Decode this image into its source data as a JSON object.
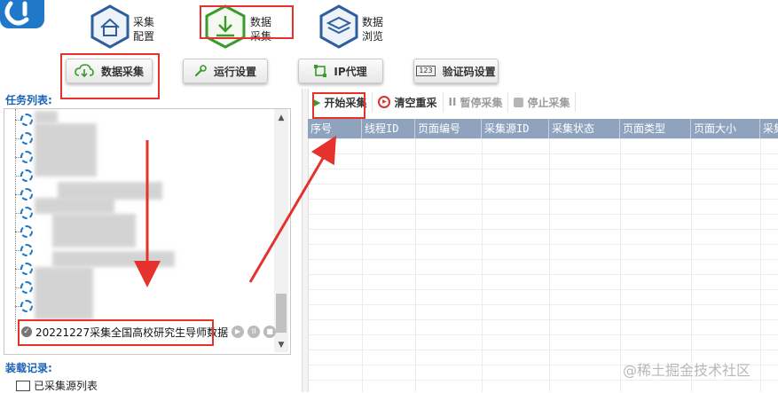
{
  "header": {
    "nav": [
      {
        "line1": "采集",
        "line2": "配置"
      },
      {
        "line1": "数据",
        "line2": "采集"
      },
      {
        "line1": "数据",
        "line2": "浏览"
      }
    ]
  },
  "toolbar": {
    "data_collect": "数据采集",
    "run_settings": "运行设置",
    "ip_proxy": "IP代理",
    "captcha_settings": "验证码设置",
    "captcha_icon_text": "123"
  },
  "left": {
    "task_list_title": "任务列表:",
    "task_item_label": "20221227采集全国高校研究生导师数据",
    "load_title": "装载记录:",
    "load_item": "已采集源列表"
  },
  "controls": {
    "start": "开始采集",
    "clear": "清空重采",
    "pause": "暂停采集",
    "stop": "停止采集"
  },
  "grid": {
    "columns": [
      "序号",
      "线程ID",
      "页面编号",
      "采集源ID",
      "采集状态",
      "页面类型",
      "页面大小",
      "采集"
    ]
  },
  "watermark": "@稀土掘金技术社区",
  "colors": {
    "accent_green": "#3a9a2c",
    "header_blue": "#8fa3bf",
    "annotation_red": "#e5322d",
    "title_blue": "#1b63b5"
  }
}
